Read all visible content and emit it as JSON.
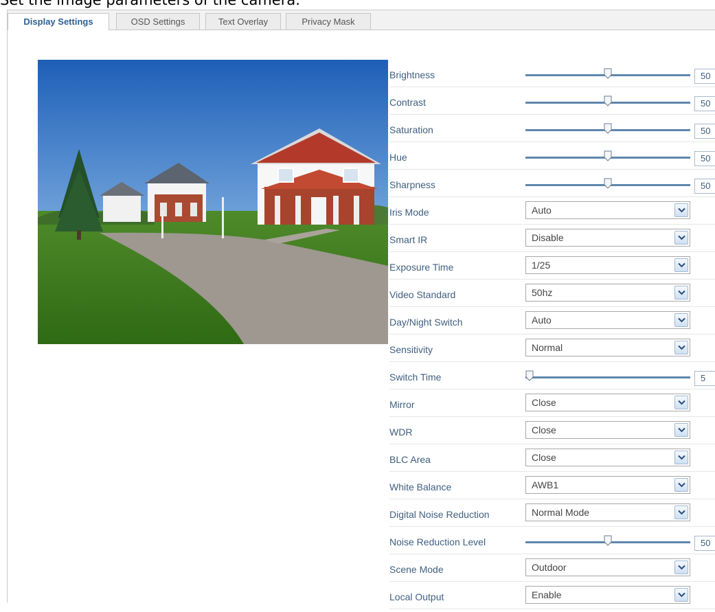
{
  "caption": "Set the image parameters of the camera.",
  "tabs": [
    {
      "label": "Display Settings",
      "active": true
    },
    {
      "label": "OSD Settings",
      "active": false
    },
    {
      "label": "Text Overlay",
      "active": false
    },
    {
      "label": "Privacy Mask",
      "active": false
    }
  ],
  "colors": {
    "accent": "#2d5f91",
    "label": "#3f5f80",
    "track": "#5e86ac"
  },
  "settings": [
    {
      "label": "Brightness",
      "type": "slider",
      "value": "50",
      "fraction": 0.5
    },
    {
      "label": "Contrast",
      "type": "slider",
      "value": "50",
      "fraction": 0.5
    },
    {
      "label": "Saturation",
      "type": "slider",
      "value": "50",
      "fraction": 0.5
    },
    {
      "label": "Hue",
      "type": "slider",
      "value": "50",
      "fraction": 0.5
    },
    {
      "label": "Sharpness",
      "type": "slider",
      "value": "50",
      "fraction": 0.5
    },
    {
      "label": "Iris Mode",
      "type": "select",
      "value": "Auto"
    },
    {
      "label": "Smart IR",
      "type": "select",
      "value": "Disable"
    },
    {
      "label": "Exposure Time",
      "type": "select",
      "value": "1/25"
    },
    {
      "label": "Video Standard",
      "type": "select",
      "value": "50hz"
    },
    {
      "label": "Day/Night Switch",
      "type": "select",
      "value": "Auto"
    },
    {
      "label": "Sensitivity",
      "type": "select",
      "value": "Normal"
    },
    {
      "label": "Switch Time",
      "type": "slider",
      "value": "5",
      "fraction": 0.0
    },
    {
      "label": "Mirror",
      "type": "select",
      "value": "Close"
    },
    {
      "label": "WDR",
      "type": "select",
      "value": "Close"
    },
    {
      "label": "BLC Area",
      "type": "select",
      "value": "Close"
    },
    {
      "label": "White Balance",
      "type": "select",
      "value": "AWB1"
    },
    {
      "label": "Digital Noise Reduction",
      "type": "select",
      "value": "Normal Mode"
    },
    {
      "label": "Noise Reduction Level",
      "type": "slider",
      "value": "50",
      "fraction": 0.5
    },
    {
      "label": "Scene Mode",
      "type": "select",
      "value": "Outdoor"
    },
    {
      "label": "Local Output",
      "type": "select",
      "value": "Enable"
    }
  ]
}
